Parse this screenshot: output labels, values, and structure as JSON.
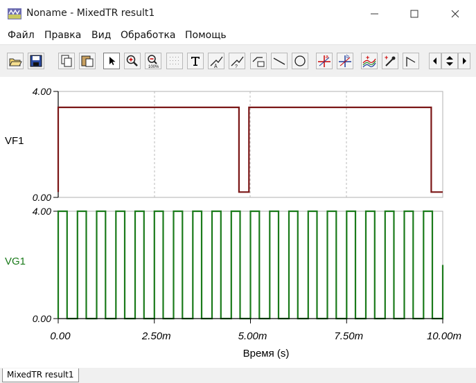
{
  "window": {
    "title": "Noname - MixedTR result1"
  },
  "menu": [
    "Файл",
    "Правка",
    "Вид",
    "Обработка",
    "Помощь"
  ],
  "toolbar": {
    "buttons": [
      "open-icon",
      "save-icon",
      "copy-icon",
      "paste-icon",
      "pointer-icon",
      "zoom-in-icon",
      "zoom-100-icon",
      "grid-icon",
      "text-icon",
      "tool-a-icon",
      "tool-b-icon",
      "tool-c-icon",
      "line-icon",
      "ellipse-icon",
      "cursor-a-icon",
      "cursor-b-icon",
      "curves-icon",
      "picker-icon",
      "angle-icon",
      "nav-left-icon",
      "nav-updown-icon",
      "nav-right-icon"
    ]
  },
  "chart_data": {
    "type": "line",
    "xlabel": "Время (s)",
    "xlim": [
      0,
      10
    ],
    "xunit": "ms",
    "x_ticks": [
      "0.00",
      "2.50m",
      "5.00m",
      "7.50m",
      "10.00m"
    ],
    "panels": [
      {
        "name": "VF1",
        "color": "#7a1515",
        "ylim": [
          0,
          4
        ],
        "y_ticks": [
          "0.00",
          "4.00"
        ],
        "points": [
          [
            0,
            0.2
          ],
          [
            0,
            3.4
          ],
          [
            4.7,
            3.4
          ],
          [
            4.7,
            0.2
          ],
          [
            4.96,
            0.2
          ],
          [
            4.96,
            3.4
          ],
          [
            9.7,
            3.4
          ],
          [
            9.7,
            0.2
          ],
          [
            10.0,
            0.2
          ]
        ]
      },
      {
        "name": "VG1",
        "color": "#1a7a1a",
        "ylim": [
          0,
          4
        ],
        "y_ticks": [
          "0.00",
          "4.00"
        ],
        "period": 0.5,
        "duty": 0.46,
        "high": 4.0,
        "low": 0.0,
        "end_value": 2.0
      }
    ]
  },
  "status": {
    "tab": "MixedTR result1"
  }
}
